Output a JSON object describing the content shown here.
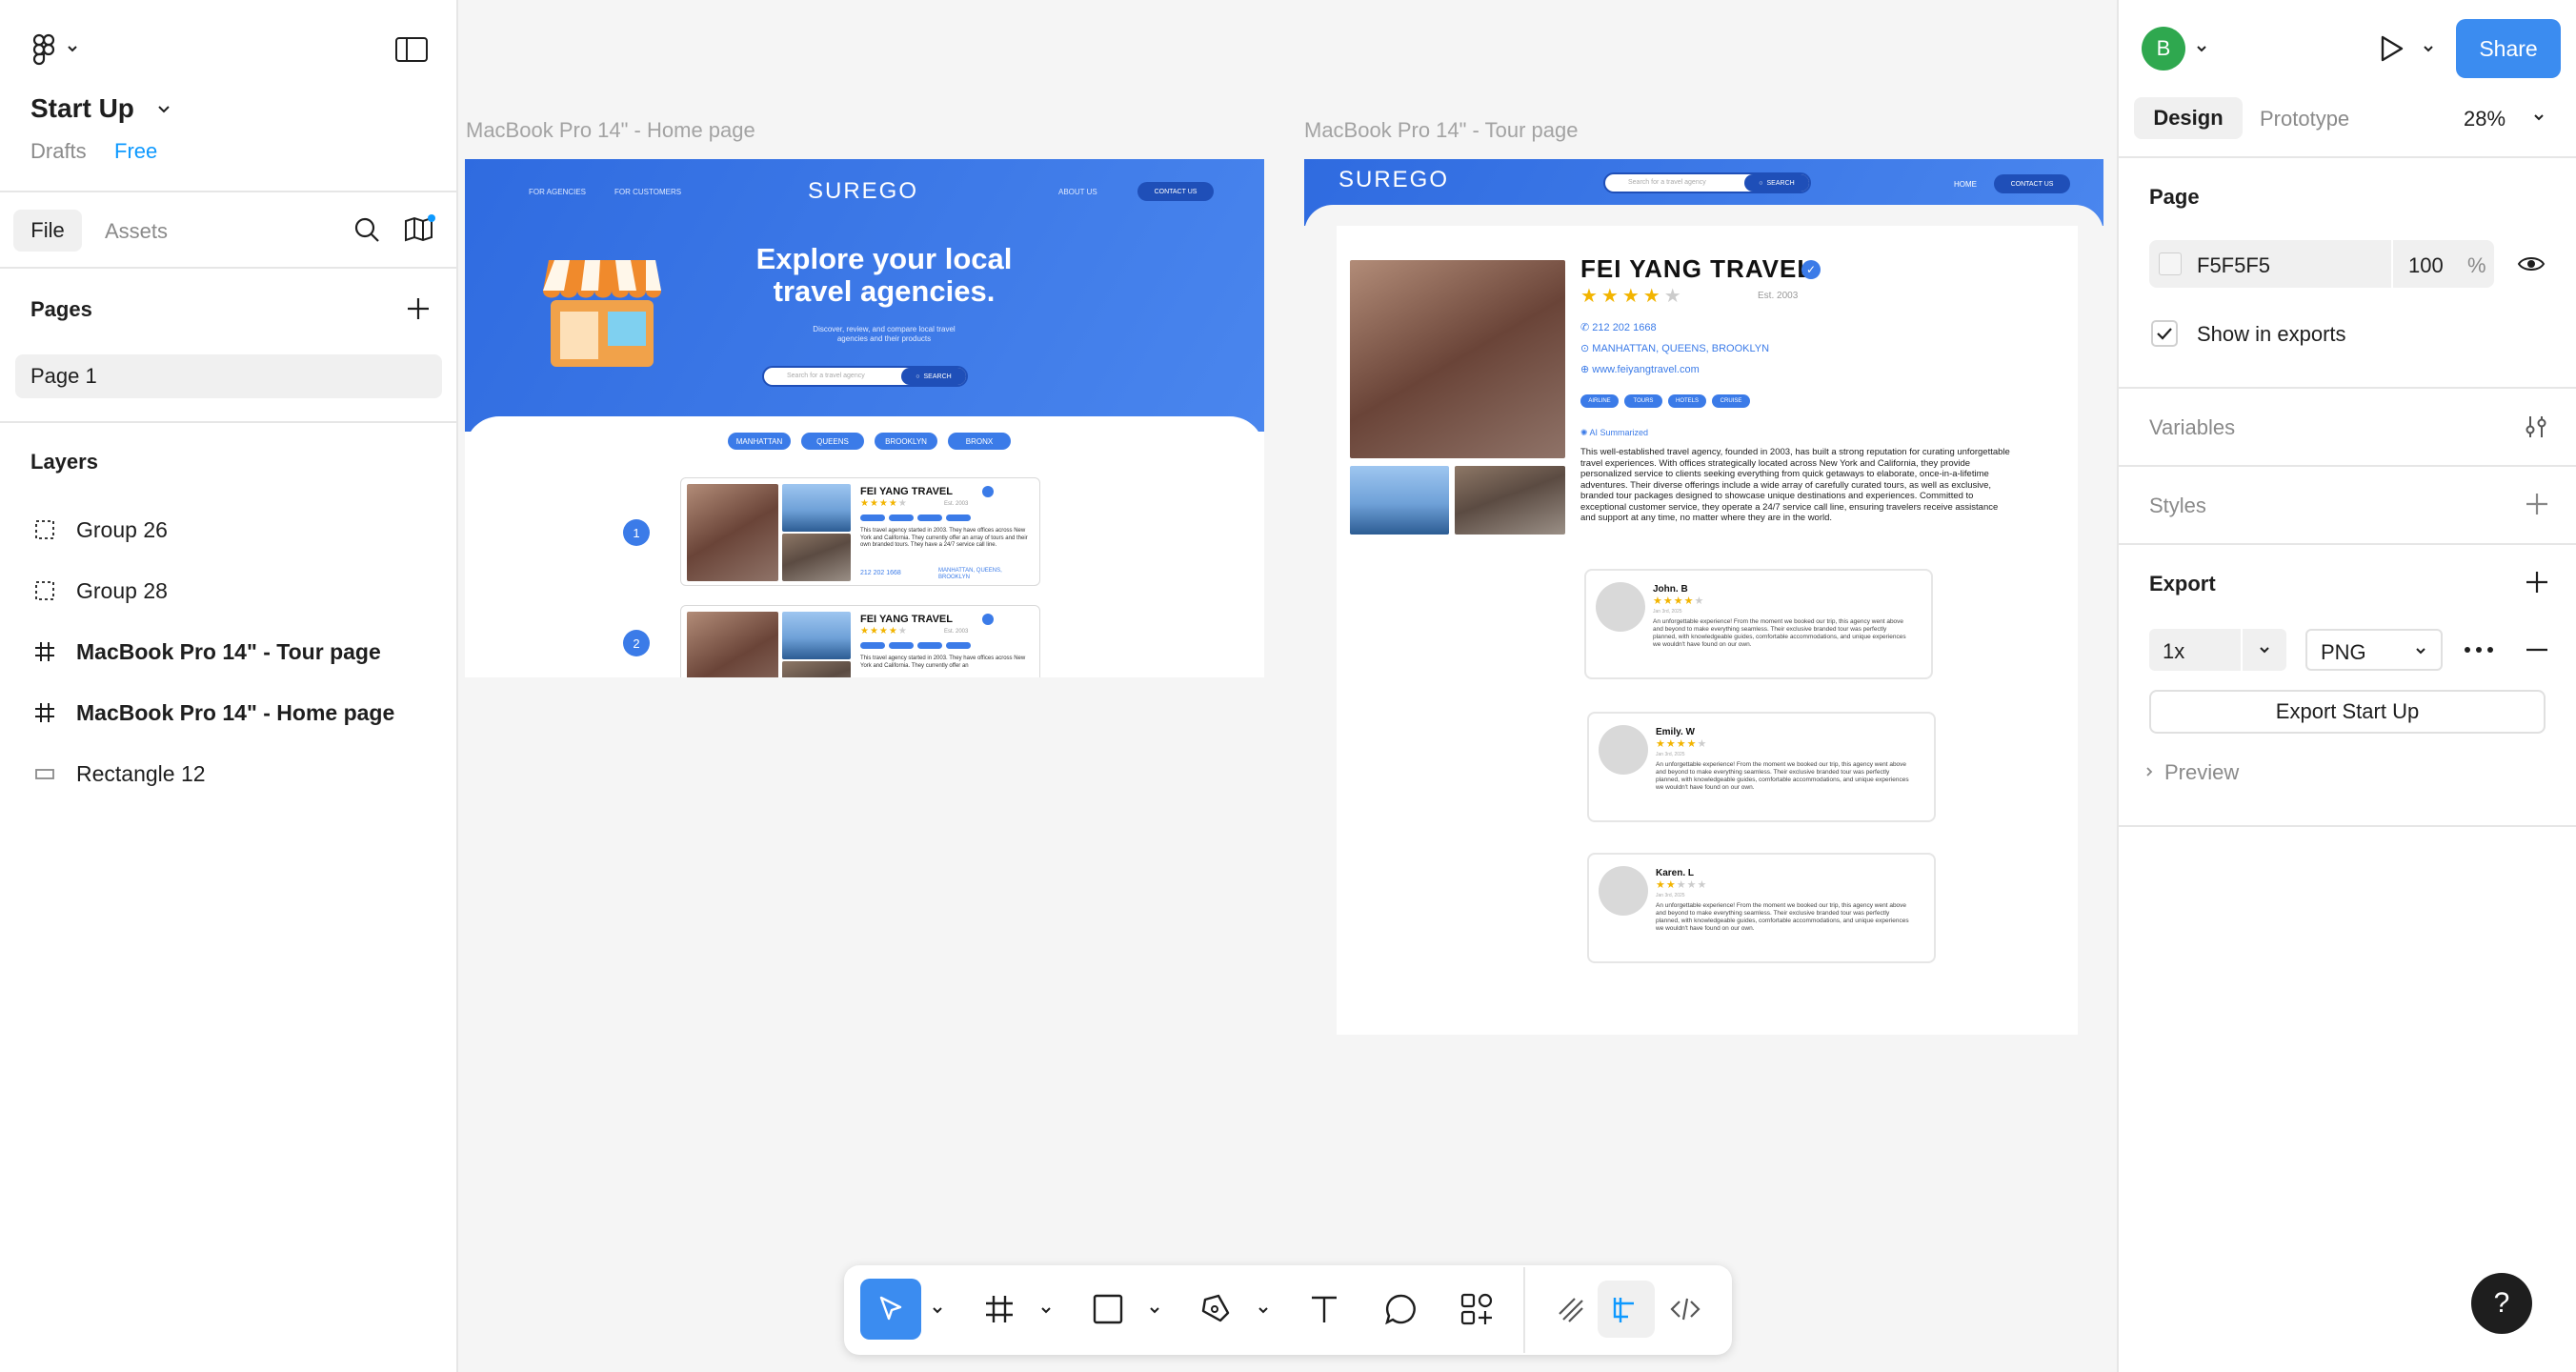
{
  "file": {
    "name": "Start Up",
    "location": "Drafts",
    "plan": "Free"
  },
  "left_tabs": {
    "file": "File",
    "assets": "Assets"
  },
  "pages": {
    "title": "Pages",
    "items": [
      "Page 1"
    ]
  },
  "layers": {
    "title": "Layers",
    "items": [
      {
        "name": "Group 26",
        "icon": "group-icon",
        "bold": false
      },
      {
        "name": "Group 28",
        "icon": "group-icon",
        "bold": false
      },
      {
        "name": "MacBook Pro 14\" - Tour page",
        "icon": "frame-icon",
        "bold": true
      },
      {
        "name": "MacBook Pro 14\" - Home page",
        "icon": "frame-icon",
        "bold": true
      },
      {
        "name": "Rectangle 12",
        "icon": "rectangle-icon",
        "bold": false
      }
    ]
  },
  "canvas": {
    "home_label": "MacBook Pro 14\" - Home page",
    "tour_label": "MacBook Pro 14\" - Tour page"
  },
  "home": {
    "nav_agencies": "FOR AGENCIES",
    "nav_customers": "FOR CUSTOMERS",
    "logo": "SUREGO",
    "nav_about": "ABOUT US",
    "nav_contact": "CONTACT US",
    "hero_line1": "Explore your local",
    "hero_line2": "travel agencies.",
    "hero_sub1": "Discover, review, and compare local travel",
    "hero_sub2": "agencies and their products",
    "search_placeholder": "Search for a travel agency",
    "search_btn": "SEARCH",
    "boroughs": [
      "MANHATTAN",
      "QUEENS",
      "BROOKLYN",
      "BRONX"
    ],
    "results": [
      {
        "num": "1",
        "name": "FEI YANG TRAVEL",
        "est": "Est. 2003",
        "desc": "This travel agency started in 2003. They have offices across New York and California. They currently offer an array of tours and their own branded tours. They have a 24/7 service call line.",
        "phone": "212 202 1668",
        "areas": "MANHATTAN, QUEENS, BROOKLYN"
      },
      {
        "num": "2",
        "name": "FEI YANG TRAVEL",
        "est": "Est. 2003",
        "desc": "This travel agency started in 2003. They have offices across New York and California. They currently offer an",
        "phone": "",
        "areas": ""
      }
    ]
  },
  "tour": {
    "logo": "SUREGO",
    "search_placeholder": "Search for a travel agency",
    "search_btn": "SEARCH",
    "nav_home": "HOME",
    "nav_contact": "CONTACT US",
    "agency_name": "FEI YANG TRAVEL",
    "est": "Est. 2003",
    "phone": "212 202 1668",
    "areas": "MANHATTAN, QUEENS, BROOKLYN",
    "website": "www.feiyangtravel.com",
    "tags": [
      "AIRLINE",
      "TOURS",
      "HOTELS",
      "CRUISE"
    ],
    "ai_label": "AI Summarized",
    "summary": "This well-established travel agency, founded in 2003, has built a strong reputation for curating unforgettable travel experiences. With offices strategically located across New York and California, they provide personalized service to clients seeking everything from quick getaways to elaborate, once-in-a-lifetime adventures. Their diverse offerings include a wide array of carefully curated tours, as well as exclusive, branded tour packages designed to showcase unique destinations and experiences. Committed to exceptional customer service, they operate a 24/7 service call line, ensuring travelers receive assistance and support at any time, no matter where they are in the world.",
    "reviews": [
      {
        "name": "John. B",
        "date": "Jan 3rd, 2025",
        "stars": 4,
        "text": "An unforgettable experience! From the moment we booked our trip, this agency went above and beyond to make everything seamless. Their exclusive branded tour was perfectly planned, with knowledgeable guides, comfortable accommodations, and unique experiences we wouldn't have found on our own."
      },
      {
        "name": "Emily. W",
        "date": "Jan 3rd, 2025",
        "stars": 4,
        "text": "An unforgettable experience! From the moment we booked our trip, this agency went above and beyond to make everything seamless. Their exclusive branded tour was perfectly planned, with knowledgeable guides, comfortable accommodations, and unique experiences we wouldn't have found on our own."
      },
      {
        "name": "Karen. L",
        "date": "Jan 3rd, 2025",
        "stars": 2,
        "text": "An unforgettable experience! From the moment we booked our trip, this agency went above and beyond to make everything seamless. Their exclusive branded tour was perfectly planned, with knowledgeable guides, comfortable accommodations, and unique experiences we wouldn't have found on our own."
      }
    ]
  },
  "right_panel": {
    "avatar_letter": "B",
    "share": "Share",
    "tabs": {
      "design": "Design",
      "prototype": "Prototype"
    },
    "zoom": "28%",
    "page_section": "Page",
    "page_color": "F5F5F5",
    "page_opacity": "100",
    "percent": "%",
    "show_in_exports": "Show in exports",
    "variables": "Variables",
    "styles": "Styles",
    "export": "Export",
    "export_scale": "1x",
    "export_format": "PNG",
    "export_button": "Export Start Up",
    "preview": "Preview"
  },
  "help": "?",
  "colors": {
    "accent": "#0d99ff",
    "share_bg": "#3b8cf0",
    "avatar_bg": "#2fa84f",
    "brand_blue": "#3b7be8",
    "canvas_bg": "#F5F5F5"
  }
}
